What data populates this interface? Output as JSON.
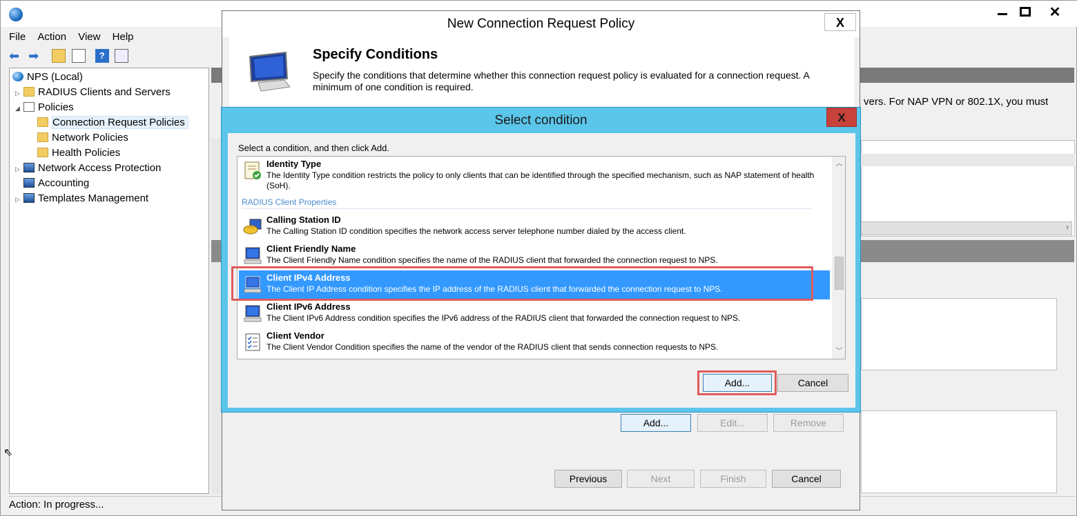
{
  "main": {
    "title_hint": "",
    "menu": [
      "File",
      "Action",
      "View",
      "Help"
    ],
    "tree": [
      {
        "label": "NPS (Local)"
      },
      {
        "label": "RADIUS Clients and Servers"
      },
      {
        "label": "Policies"
      },
      {
        "label": "Connection Request Policies"
      },
      {
        "label": "Network Policies"
      },
      {
        "label": "Health Policies"
      },
      {
        "label": "Network Access Protection"
      },
      {
        "label": "Accounting"
      },
      {
        "label": "Templates Management"
      }
    ],
    "right_text": "vers. For NAP VPN or 802.1X, you must",
    "status": "Action:  In progress..."
  },
  "wizard": {
    "title": "New Connection Request Policy",
    "close": "X",
    "heading": "Specify Conditions",
    "description": "Specify the conditions that determine whether this connection request policy is evaluated for a connection request. A minimum of one condition is required.",
    "buttons": {
      "add": "Add...",
      "edit": "Edit...",
      "remove": "Remove",
      "previous": "Previous",
      "next": "Next",
      "finish": "Finish",
      "cancel": "Cancel"
    }
  },
  "select": {
    "title": "Select condition",
    "close": "X",
    "instruction": "Select a condition, and then click Add.",
    "group": "RADIUS Client Properties",
    "items": [
      {
        "title": "Identity Type",
        "desc": "The Identity Type condition restricts the policy to only clients that can be identified through the specified mechanism, such as NAP statement of health (SoH).",
        "icon": "certificate-icon"
      },
      {
        "title": "Calling Station ID",
        "desc": "The Calling Station ID condition specifies the network access server telephone number dialed by the access client.",
        "icon": "phone-icon"
      },
      {
        "title": "Client Friendly Name",
        "desc": "The Client Friendly Name condition specifies the name of the RADIUS client that forwarded the connection request to NPS.",
        "icon": "computer-icon"
      },
      {
        "title": "Client IPv4 Address",
        "desc": "The Client IP Address condition specifies the IP address of the RADIUS client that forwarded the connection request to NPS.",
        "icon": "computer-icon",
        "selected": true
      },
      {
        "title": "Client IPv6 Address",
        "desc": "The Client IPv6 Address condition specifies the IPv6 address of the RADIUS client that forwarded the connection request to NPS.",
        "icon": "computer-icon"
      },
      {
        "title": "Client Vendor",
        "desc": "The Client Vendor Condition specifies the name of the vendor of the RADIUS client that sends connection requests to NPS.",
        "icon": "checklist-icon"
      }
    ],
    "add": "Add...",
    "cancel": "Cancel"
  }
}
